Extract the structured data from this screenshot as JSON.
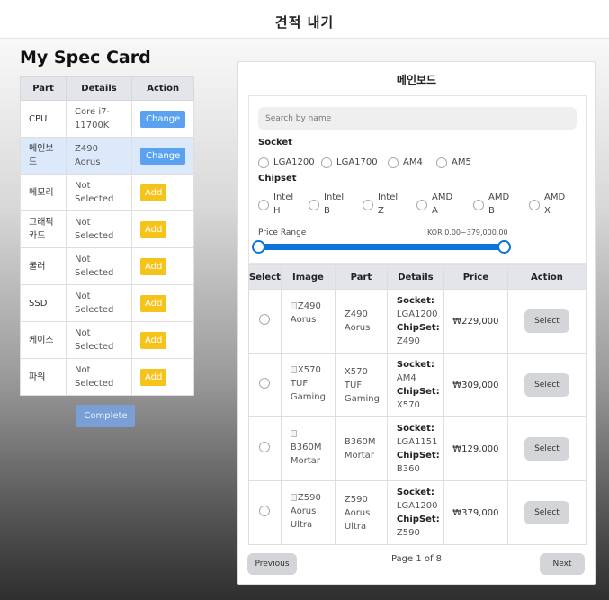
{
  "header": {
    "title": "견적 내기"
  },
  "spec": {
    "title": "My Spec Card",
    "columns": [
      "Part",
      "Details",
      "Action"
    ],
    "rows": [
      {
        "part": "CPU",
        "details": "Core i7-11700K",
        "action": "Change"
      },
      {
        "part": "메인보드",
        "details": "Z490 Aorus",
        "action": "Change"
      },
      {
        "part": "메모리",
        "details": "Not Selected",
        "action": "Add"
      },
      {
        "part": "그래픽카드",
        "details": "Not Selected",
        "action": "Add"
      },
      {
        "part": "쿨러",
        "details": "Not Selected",
        "action": "Add"
      },
      {
        "part": "SSD",
        "details": "Not Selected",
        "action": "Add"
      },
      {
        "part": "케이스",
        "details": "Not Selected",
        "action": "Add"
      },
      {
        "part": "파워",
        "details": "Not Selected",
        "action": "Add"
      }
    ],
    "complete_label": "Complete"
  },
  "panel": {
    "title": "메인보드",
    "search_placeholder": "Search by name",
    "socket_label": "Socket",
    "sockets": [
      "LGA1200",
      "LGA1700",
      "AM4",
      "AM5"
    ],
    "chipset_label": "Chipset",
    "chipsets": [
      [
        "Intel",
        "H"
      ],
      [
        "Intel",
        "B"
      ],
      [
        "Intel",
        "Z"
      ],
      [
        "AMD",
        "A"
      ],
      [
        "AMD",
        "B"
      ],
      [
        "AMD",
        "X"
      ]
    ],
    "price_label": "Price Range",
    "price_value": "KOR 0.00~379,000.00",
    "price_range": [
      0,
      379000
    ],
    "table_columns": [
      "Select",
      "Image",
      "Part",
      "Details",
      "Price",
      "Action"
    ],
    "socket_key": "Socket:",
    "chipset_key": "ChipSet:",
    "products": [
      {
        "image_alt": "Z490 Aorus",
        "part": "Z490 Aorus",
        "socket": "LGA1200",
        "chipset": "Z490",
        "price": "₩229,000",
        "action": "Select"
      },
      {
        "image_alt": "X570 TUF Gaming",
        "part": "X570 TUF Gaming",
        "socket": "AM4",
        "chipset": "X570",
        "price": "₩309,000",
        "action": "Select"
      },
      {
        "image_alt": "B360M Mortar",
        "part": "B360M Mortar",
        "socket": "LGA1151",
        "chipset": "B360",
        "price": "₩129,000",
        "action": "Select"
      },
      {
        "image_alt": "Z590 Aorus Ultra",
        "part": "Z590 Aorus Ultra",
        "socket": "LGA1200",
        "chipset": "Z590",
        "price": "₩379,000",
        "action": "Select"
      }
    ],
    "prev_label": "Previous",
    "next_label": "Next",
    "page_info": "Page 1 of 8"
  },
  "colors": {
    "change_button": "#5aa2ef",
    "add_button": "#f6c31b",
    "slider": "#0a74da",
    "selected_row": "#dbe9fb"
  }
}
